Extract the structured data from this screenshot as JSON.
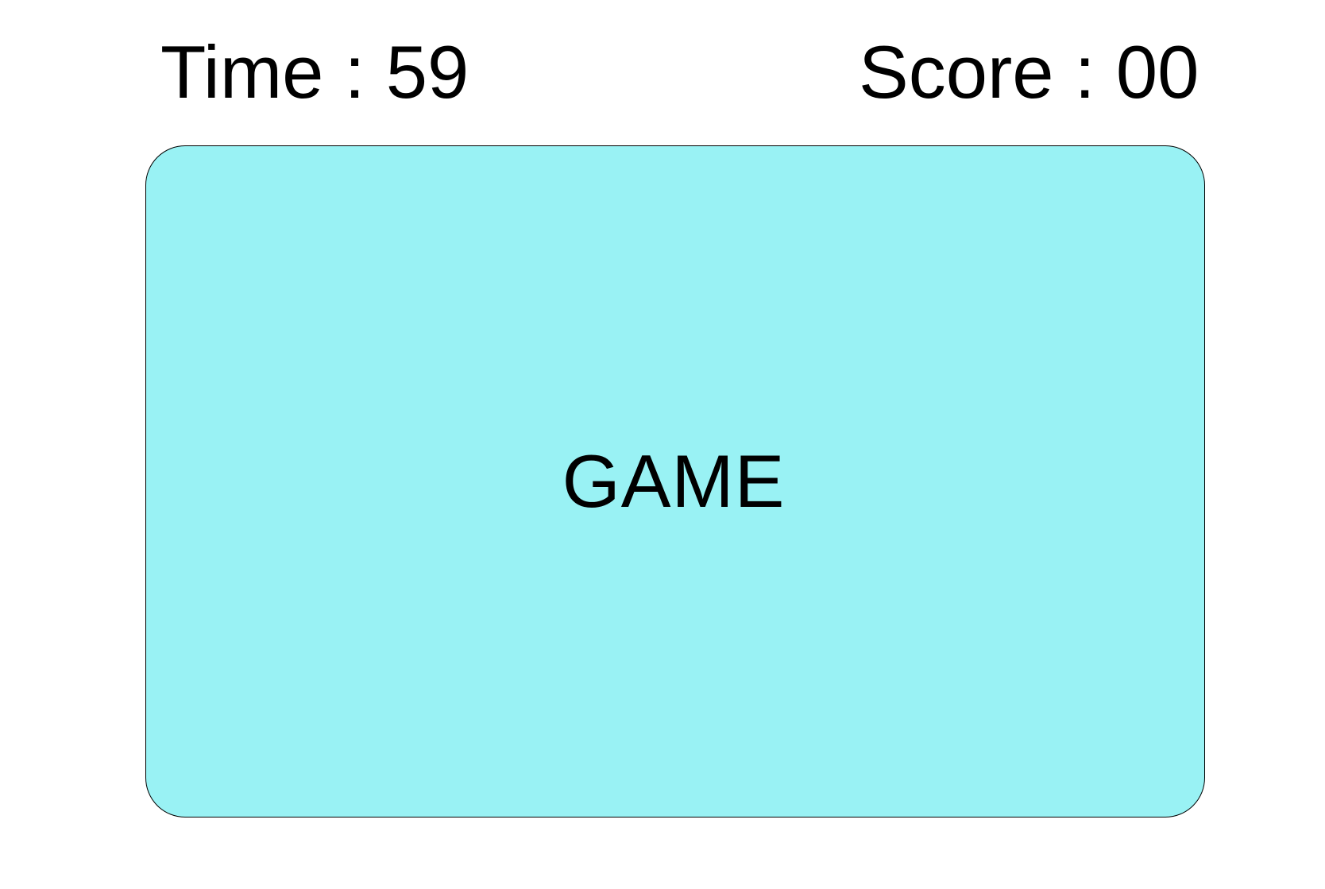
{
  "hud": {
    "time_label": "Time : 59",
    "score_label": "Score : 00"
  },
  "board": {
    "title": "GAME",
    "background_color": "#99f2f4",
    "border_color": "#000000"
  }
}
